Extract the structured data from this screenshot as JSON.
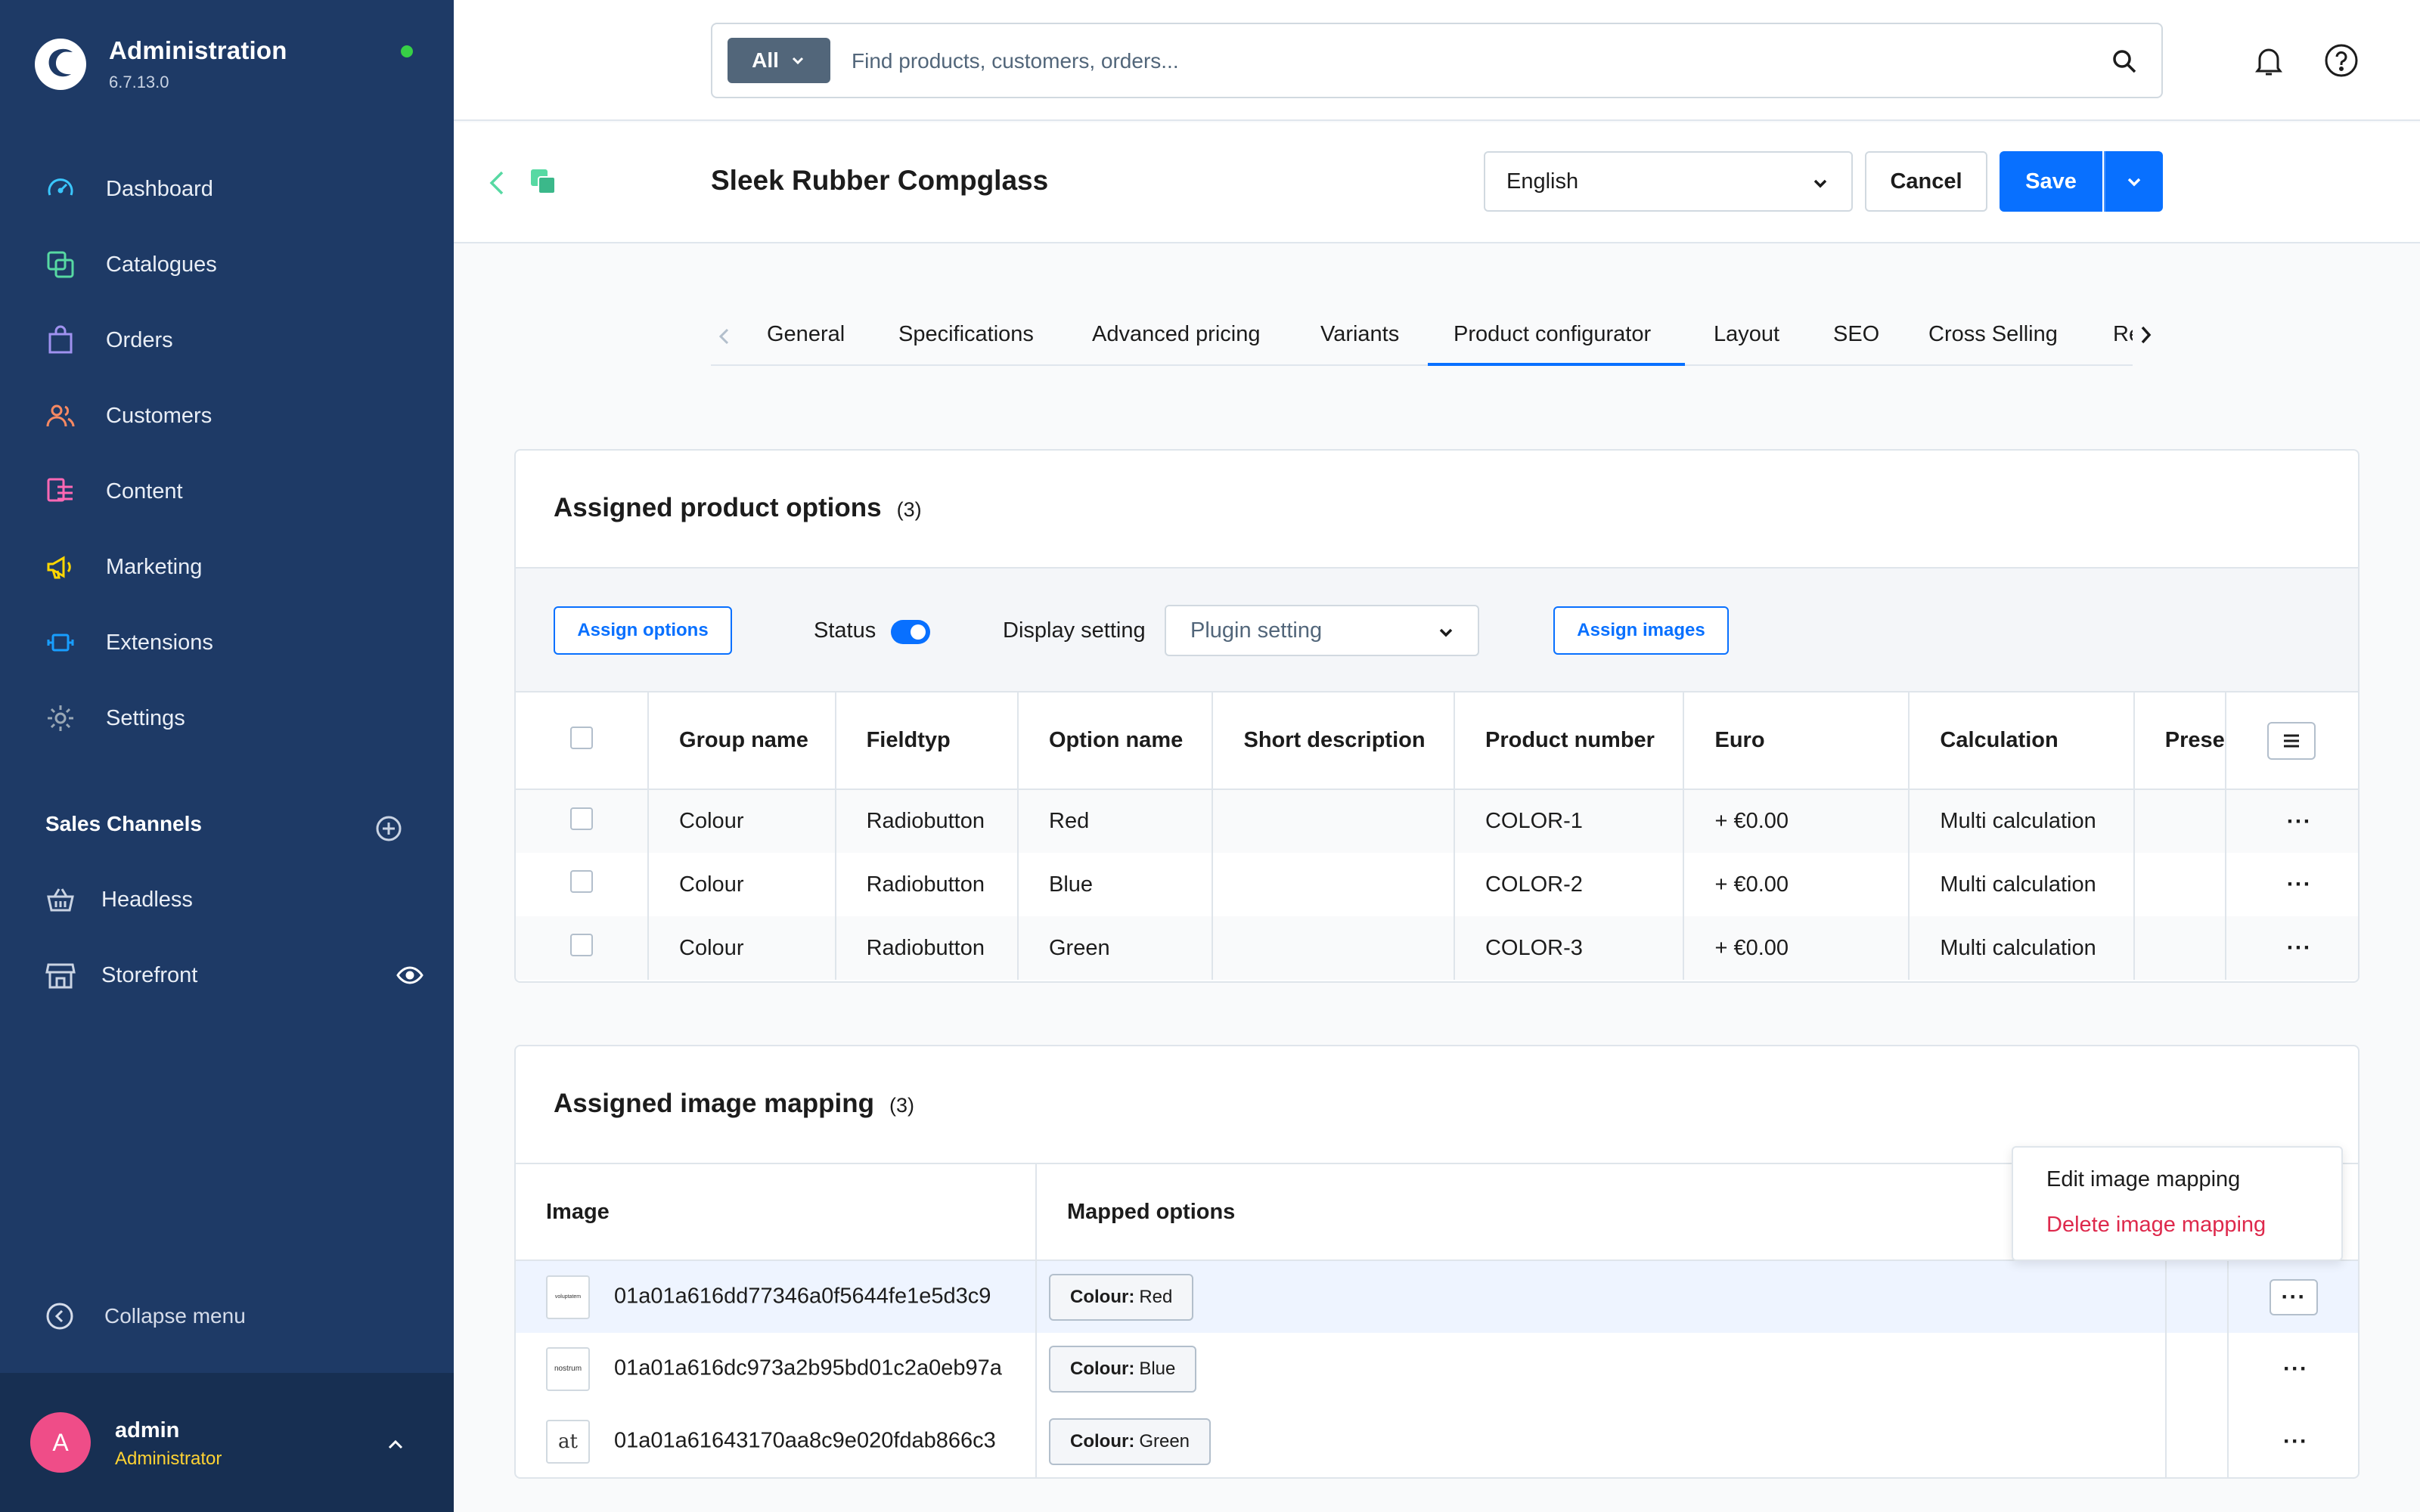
{
  "app": {
    "title": "Administration",
    "version": "6.7.13.0"
  },
  "nav": [
    {
      "label": "Dashboard",
      "icon": "dashboard-icon",
      "color": "#3ac7ff"
    },
    {
      "label": "Catalogues",
      "icon": "catalogue-icon",
      "color": "#57d9a3"
    },
    {
      "label": "Orders",
      "icon": "orders-icon",
      "color": "#a092f0"
    },
    {
      "label": "Customers",
      "icon": "customers-icon",
      "color": "#f88962"
    },
    {
      "label": "Content",
      "icon": "content-icon",
      "color": "#ff68b4"
    },
    {
      "label": "Marketing",
      "icon": "marketing-icon",
      "color": "#ffd700"
    },
    {
      "label": "Extensions",
      "icon": "extensions-icon",
      "color": "#189eff"
    },
    {
      "label": "Settings",
      "icon": "settings-icon",
      "color": "#9aa8b5"
    }
  ],
  "sales_channels": {
    "header": "Sales Channels",
    "items": [
      {
        "label": "Headless",
        "icon": "basket-icon"
      },
      {
        "label": "Storefront",
        "icon": "storefront-icon"
      }
    ]
  },
  "collapse_label": "Collapse menu",
  "user": {
    "initial": "A",
    "name": "admin",
    "role": "Administrator"
  },
  "search": {
    "scope": "All",
    "placeholder": "Find products, customers, orders..."
  },
  "smartbar": {
    "title": "Sleek Rubber Compglass",
    "language": "English",
    "cancel": "Cancel",
    "save": "Save"
  },
  "tabs": [
    {
      "label": "General"
    },
    {
      "label": "Specifications"
    },
    {
      "label": "Advanced pricing"
    },
    {
      "label": "Variants"
    },
    {
      "label": "Product configurator",
      "active": true
    },
    {
      "label": "Layout"
    },
    {
      "label": "SEO"
    },
    {
      "label": "Cross Selling"
    },
    {
      "label": "Re"
    }
  ],
  "options_card": {
    "title": "Assigned product options",
    "count": "(3)",
    "assign_options": "Assign options",
    "status_label": "Status",
    "status_on": true,
    "display_label": "Display setting",
    "display_value": "Plugin setting",
    "assign_images": "Assign images",
    "columns": [
      "Group name",
      "Fieldtyp",
      "Option name",
      "Short description",
      "Product number",
      "Euro",
      "Calculation",
      "Prese"
    ],
    "rows": [
      {
        "group": "Colour",
        "field": "Radiobutton",
        "option": "Red",
        "short": "",
        "number": "COLOR-1",
        "euro": "+ €0.00",
        "calc": "Multi calculation"
      },
      {
        "group": "Colour",
        "field": "Radiobutton",
        "option": "Blue",
        "short": "",
        "number": "COLOR-2",
        "euro": "+ €0.00",
        "calc": "Multi calculation"
      },
      {
        "group": "Colour",
        "field": "Radiobutton",
        "option": "Green",
        "short": "",
        "number": "COLOR-3",
        "euro": "+ €0.00",
        "calc": "Multi calculation"
      }
    ]
  },
  "mapping_card": {
    "title": "Assigned image mapping",
    "count": "(3)",
    "columns": [
      "Image",
      "Mapped options"
    ],
    "rows": [
      {
        "thumb": "voluptatem",
        "name": "01a01a616dd77346a0f5644fe1e5d3c9",
        "chip_key": "Colour:",
        "chip_val": "Red"
      },
      {
        "thumb": "nostrum",
        "name": "01a01a616dc973a2b95bd01c2a0eb97a",
        "chip_key": "Colour:",
        "chip_val": "Blue"
      },
      {
        "thumb": "at",
        "name": "01a01a61643170aa8c9e020fdab866c3",
        "chip_key": "Colour:",
        "chip_val": "Green"
      }
    ],
    "context_menu": {
      "edit": "Edit image mapping",
      "delete": "Delete image mapping"
    }
  },
  "colors": {
    "sidebar": "#1e3a66",
    "primary": "#0870ff",
    "danger": "#de294c"
  }
}
